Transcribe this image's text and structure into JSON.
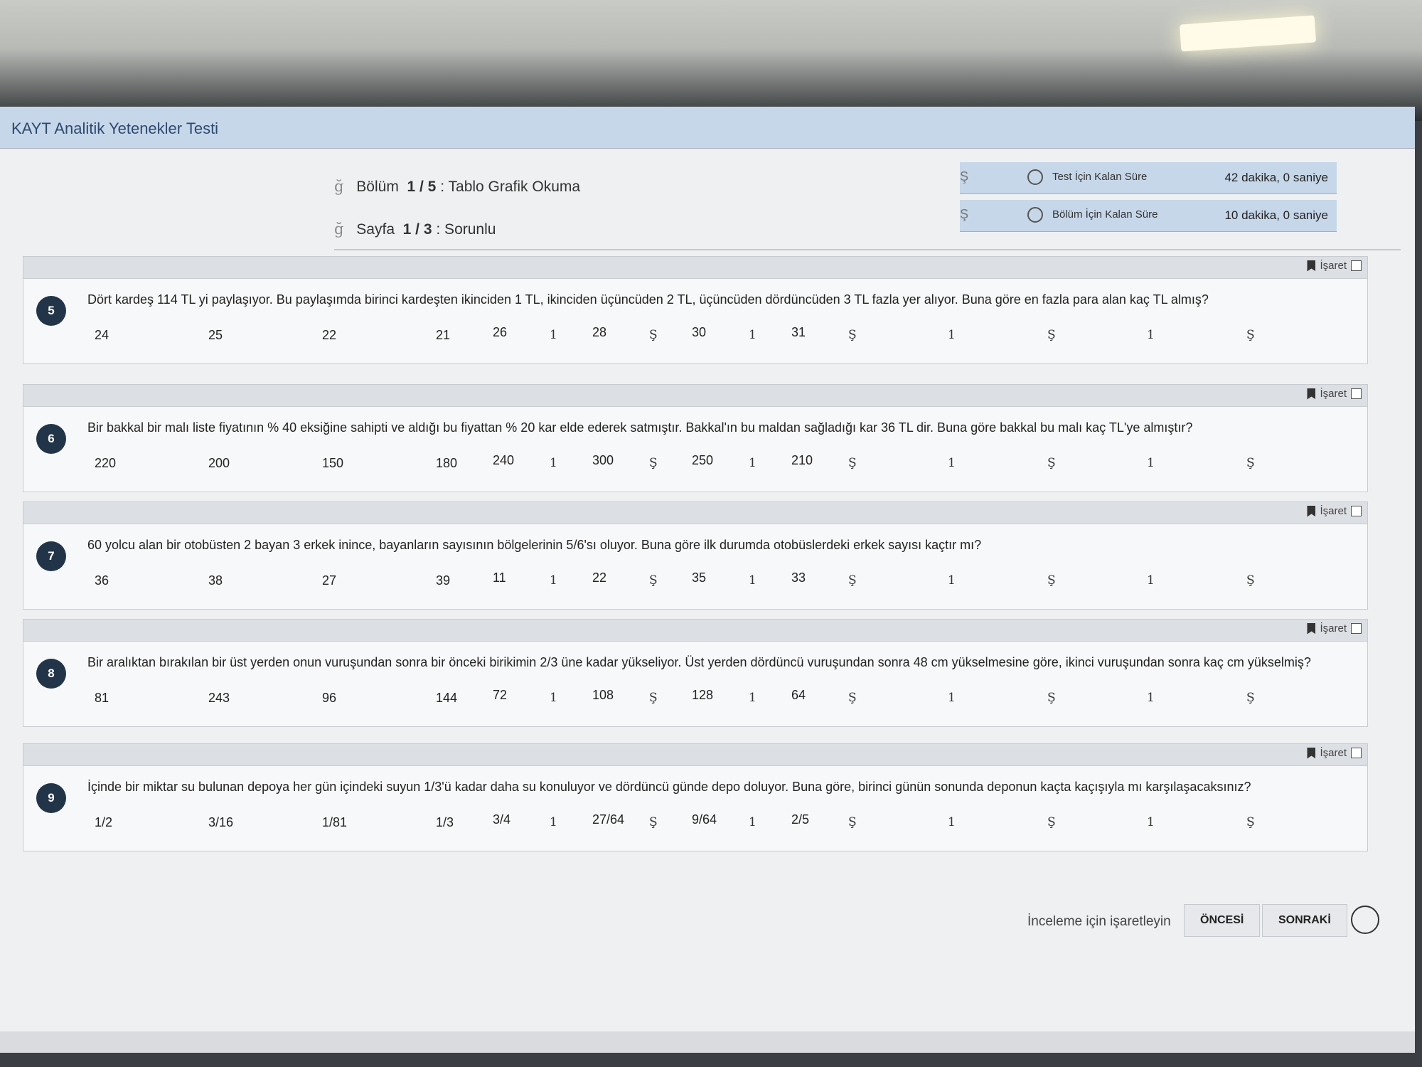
{
  "app": {
    "title": "KAYT Analitik Yetenekler Testi"
  },
  "section": {
    "glyph": "ğ",
    "label": "Bölüm",
    "value": "1 / 5",
    "name": ": Tablo Grafik Okuma"
  },
  "page": {
    "glyph": "ğ",
    "label": "Sayfa",
    "value": "1 / 3",
    "name": ": Sorunlu"
  },
  "timers": [
    {
      "glyph": "Ş",
      "label": "Test İçin Kalan Süre",
      "value": "42 dakika, 0 saniye"
    },
    {
      "glyph": "Ş",
      "label": "Bölüm İçin Kalan Süre",
      "value": "10 dakika, 0 saniye"
    }
  ],
  "mark_label": "İşaret",
  "questions": [
    {
      "num": "5",
      "text": "Dört kardeş 114 TL yi paylaşıyor. Bu paylaşımda birinci kardeşten ikinciden 1 TL, ikinciden üçüncüden 2 TL, üçüncüden dördüncüden 3 TL fazla yer alıyor. Buna göre en fazla para alan kaç TL almış?",
      "choices": [
        "24",
        "25",
        "22",
        "21"
      ],
      "extra": [
        "26",
        "28",
        "30",
        "31"
      ]
    },
    {
      "num": "6",
      "text": "Bir bakkal bir malı liste fiyatının % 40 eksiğine sahipti ve aldığı bu fiyattan % 20 kar elde ederek satmıştır. Bakkal'ın bu maldan sağladığı kar 36 TL dir. Buna göre bakkal bu malı kaç TL'ye almıştır?",
      "choices": [
        "220",
        "200",
        "150",
        "180"
      ],
      "extra": [
        "240",
        "300",
        "250",
        "210"
      ]
    },
    {
      "num": "7",
      "text": "60 yolcu alan bir otobüsten 2 bayan 3 erkek inince, bayanların sayısının bölgelerinin 5/6'sı oluyor. Buna göre ilk durumda otobüslerdeki erkek sayısı kaçtır mı?",
      "choices": [
        "36",
        "38",
        "27",
        "39"
      ],
      "extra": [
        "11",
        "22",
        "35",
        "33"
      ]
    },
    {
      "num": "8",
      "text": "Bir aralıktan bırakılan bir üst yerden onun vuruşundan sonra bir önceki birikimin 2/3 üne kadar yükseliyor. Üst yerden dördüncü vuruşundan sonra 48 cm yükselmesine göre, ikinci vuruşundan sonra kaç cm yükselmiş?",
      "choices": [
        "81",
        "243",
        "96",
        "144"
      ],
      "extra": [
        "72",
        "108",
        "128",
        "64"
      ]
    },
    {
      "num": "9",
      "text": "İçinde bir miktar su bulunan depoya her gün içindeki suyun 1/3'ü kadar daha su konuluyor ve dördüncü günde depo doluyor. Buna göre, birinci günün sonunda deponun kaçta kaçışıyla mı karşılaşacaksınız?",
      "choices": [
        "1/2",
        "3/16",
        "1/81",
        "1/3"
      ],
      "extra": [
        "3/4",
        "27/64",
        "9/64",
        "2/5"
      ]
    }
  ],
  "junk": {
    "one": "1",
    "sh": "Ş"
  },
  "footer": {
    "review": "İnceleme için işaretleyin",
    "prev": "ÖNCESİ",
    "next": "SONRAKİ"
  }
}
